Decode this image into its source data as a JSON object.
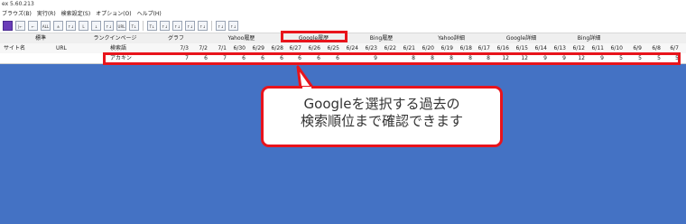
{
  "window": {
    "title": "ex 5.60.213"
  },
  "menu": [
    "ブラウズ(B)",
    "実行(R)",
    "検索設定(S)",
    "オプション(O)",
    "ヘルプ(H)"
  ],
  "toolbar_buttons": [
    "SRC",
    "|←",
    "←",
    "ALL",
    "±",
    "↑↓",
    "L",
    "↓",
    "↑↓",
    "URL",
    "T↓",
    "T↓",
    "↑↓",
    "↑↓",
    "↑↓",
    "↑↓",
    "↑↓",
    "↑↓"
  ],
  "grid": {
    "group_headers": {
      "standard": "標準",
      "ranking_page": "ランクインページ",
      "graph": "グラフ",
      "yahoo_history": "Yahoo履歴",
      "google_history": "Google履歴",
      "bing_history": "Bing履歴",
      "yahoo_detail": "Yahoo詳細",
      "google_detail": "Google詳細",
      "bing_detail": "Bing詳細"
    },
    "column_headers": {
      "site_name": "サイト名",
      "url": "URL",
      "keyword": "検索語",
      "dates": [
        "7/3",
        "7/2",
        "7/1",
        "6/30",
        "6/29",
        "6/28",
        "6/27",
        "6/26",
        "6/25",
        "6/24",
        "6/23",
        "6/22",
        "6/21",
        "6/20",
        "6/19",
        "6/18",
        "6/17",
        "6/16",
        "6/15",
        "6/14",
        "6/13",
        "6/12",
        "6/11",
        "6/10",
        "6/9",
        "6/8",
        "6/7"
      ]
    },
    "rows": [
      {
        "site_name": "",
        "url": "",
        "keyword": "アカキン",
        "values": [
          "7",
          "6",
          "7",
          "6",
          "6",
          "6",
          "6",
          "6",
          "6",
          "",
          "9",
          "",
          "8",
          "8",
          "8",
          "8",
          "8",
          "12",
          "12",
          "9",
          "9",
          "12",
          "9",
          "5",
          "5",
          "5",
          "5"
        ]
      }
    ]
  },
  "annotation": {
    "line1": "Googleを選択する過去の",
    "line2": "検索順位まで確認できます"
  },
  "colors": {
    "highlight_red": "#e8141c",
    "grid_blue": "#4472c4"
  }
}
